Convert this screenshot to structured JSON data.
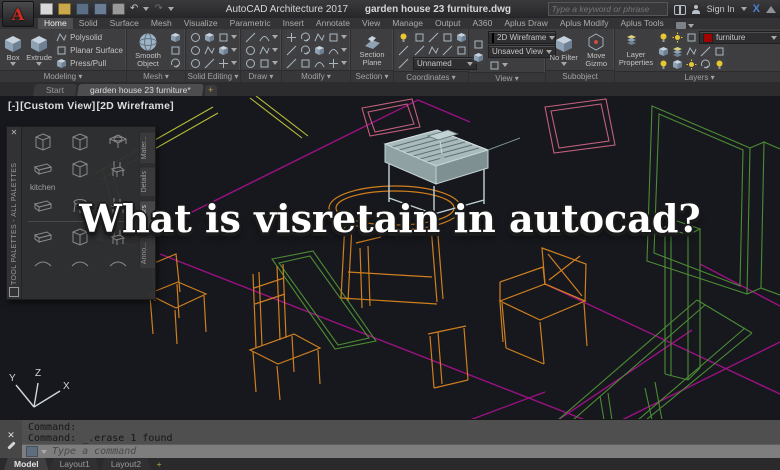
{
  "titlebar": {
    "app": "AutoCAD Architecture 2017",
    "doc": "garden house 23 furniture.dwg",
    "search_placeholder": "Type a keyword or phrase",
    "sign_in": "Sign In"
  },
  "ribbon_tabs": [
    "Home",
    "Solid",
    "Surface",
    "Mesh",
    "Visualize",
    "Parametric",
    "Insert",
    "Annotate",
    "View",
    "Manage",
    "Output",
    "A360",
    "Aplus Draw",
    "Aplus Modify",
    "Aplus Tools"
  ],
  "panels": {
    "modeling": {
      "label": "Modeling",
      "box": "Box",
      "extrude": "Extrude",
      "items": [
        "Polysolid",
        "Planar Surface",
        "Press/Pull"
      ]
    },
    "mesh": {
      "label": "Mesh",
      "smooth": "Smooth Object"
    },
    "solid_editing": {
      "label": "Solid Editing"
    },
    "draw": {
      "label": "Draw"
    },
    "modify": {
      "label": "Modify"
    },
    "section": {
      "label": "Section",
      "plane": "Section Plane"
    },
    "coordinates": {
      "label": "Coordinates",
      "view_name": "Unnamed"
    },
    "view": {
      "label": "View",
      "style": "2D Wireframe",
      "saved": "Unsaved View"
    },
    "subobject": {
      "label": "Subobject",
      "no_filter": "No Filter",
      "gizmo": "Move Gizmo"
    },
    "layers": {
      "label": "Layers",
      "props": "Layer Properties",
      "current": "furniture",
      "swatch_color": "#a00000"
    }
  },
  "doc_tabs": {
    "start": "Start",
    "active": "garden house 23 furniture*",
    "add": "+"
  },
  "viewport": {
    "vp": "[-]",
    "view": "[Custom View]",
    "style": "[2D Wireframe]",
    "overlay": "What is visretain in autocad?"
  },
  "palette": {
    "title": "TOOL PALETTES - ALL PALETTES",
    "group": "kitchen",
    "tabs": [
      "Mater...",
      "Details",
      "Interiors",
      "Anno..."
    ]
  },
  "ucs": {
    "x": "X",
    "y": "Y",
    "z": "Z"
  },
  "command": {
    "history": [
      "Command:",
      "Command: _.erase 1 found"
    ],
    "placeholder": "Type a command"
  },
  "layout_tabs": [
    "Model",
    "Layout1",
    "Layout2",
    "+"
  ],
  "glyphs": {
    "logo": "A",
    "undo": "↶",
    "redo": "↷",
    "close": "✕"
  },
  "colors": {
    "canvas": "#16181d",
    "wire_orange": "#cf7f1f",
    "wire_green": "#4c8c34",
    "wire_magenta": "#9b1182",
    "wire_yellow": "#b9bd35",
    "layer_swatch": "#a00000"
  }
}
